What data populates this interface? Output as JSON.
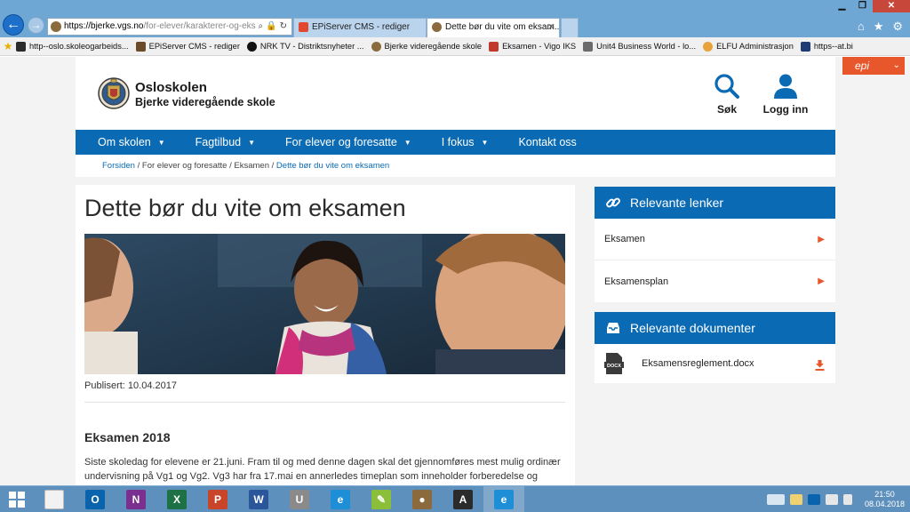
{
  "browser": {
    "url_host": "https://bjerke.vgs.no",
    "url_path": "/for-elever/karakterer-og-eksa",
    "tabs": [
      {
        "label": "EPiServer CMS - rediger",
        "active": false
      },
      {
        "label": "Dette bør du vite om eksam...",
        "active": true
      }
    ],
    "window_buttons": {
      "minimize": "▁",
      "restore": "❐",
      "close": "✕"
    },
    "bookmarks": [
      {
        "label": "http--oslo.skoleogarbeids...",
        "color": "#2b2b2b"
      },
      {
        "label": "EPiServer CMS - rediger",
        "color": "#6b4a2a"
      },
      {
        "label": "NRK TV - Distriktsnyheter ...",
        "color": "#111111"
      },
      {
        "label": "Bjerke videregående skole",
        "color": "#8b6b3e"
      },
      {
        "label": "Eksamen - Vigo IKS",
        "color": "#c0392b"
      },
      {
        "label": "Unit4 Business World - lo...",
        "color": "#6b6b6b"
      },
      {
        "label": "ELFU Administrasjon",
        "color": "#e8a33b"
      },
      {
        "label": "https--at.bi",
        "color": "#1f3b73"
      }
    ]
  },
  "header": {
    "site_name": "Osloskolen",
    "school_name": "Bjerke videregående skole",
    "search_label": "Søk",
    "login_label": "Logg inn",
    "epi_label": "epi"
  },
  "nav": {
    "items": [
      {
        "label": "Om skolen",
        "dropdown": true
      },
      {
        "label": "Fagtilbud",
        "dropdown": true
      },
      {
        "label": "For elever og foresatte",
        "dropdown": true
      },
      {
        "label": "I fokus",
        "dropdown": true
      },
      {
        "label": "Kontakt oss",
        "dropdown": false
      }
    ]
  },
  "breadcrumb": {
    "home": "Forsiden",
    "level1": "For elever og foresatte",
    "level2": "Eksamen",
    "current": "Dette bør du vite om eksamen",
    "separator": " / "
  },
  "article": {
    "title": "Dette bør du vite om eksamen",
    "published": "Publisert: 10.04.2017",
    "section_title": "Eksamen 2018",
    "body": "Siste skoledag for elevene er 21.juni. Fram til og med denne dagen skal det gjennomføres mest mulig ordinær undervisning på Vg1 og Vg2. Vg3 har fra 17.mai en annerledes timeplan som inneholder forberedelse og"
  },
  "sidebar": {
    "links_title": "Relevante lenker",
    "links": [
      {
        "label": "Eksamen"
      },
      {
        "label": "Eksamensplan"
      }
    ],
    "docs_title": "Relevante dokumenter",
    "docs": [
      {
        "label": "Eksamensreglement.docx",
        "badge": "DOCX"
      }
    ]
  },
  "taskbar": {
    "apps": [
      {
        "name": "file-explorer",
        "glyph": "",
        "color": "#f2f2f2"
      },
      {
        "name": "outlook",
        "glyph": "O",
        "color": "#0a64ad"
      },
      {
        "name": "onenote",
        "glyph": "N",
        "color": "#7b2f8e"
      },
      {
        "name": "excel",
        "glyph": "X",
        "color": "#1e7145"
      },
      {
        "name": "powerpoint",
        "glyph": "P",
        "color": "#c9452a"
      },
      {
        "name": "word",
        "glyph": "W",
        "color": "#2b579a"
      },
      {
        "name": "unit4",
        "glyph": "U",
        "color": "#8a8a8a"
      },
      {
        "name": "internet-explorer",
        "glyph": "e",
        "color": "#1e8fd6"
      },
      {
        "name": "notes",
        "glyph": "✎",
        "color": "#8bbf3a"
      },
      {
        "name": "school-crest",
        "glyph": "●",
        "color": "#8b6b3e"
      },
      {
        "name": "font-viewer",
        "glyph": "A",
        "color": "#2b2b2b"
      },
      {
        "name": "internet-explorer-active",
        "glyph": "e",
        "color": "#1e8fd6"
      }
    ],
    "time": "21:50",
    "date": "08.04.2018"
  },
  "colors": {
    "brand_blue": "#0a6ab3",
    "accent_orange": "#e8572b",
    "page_gray": "#f3f3f3"
  }
}
